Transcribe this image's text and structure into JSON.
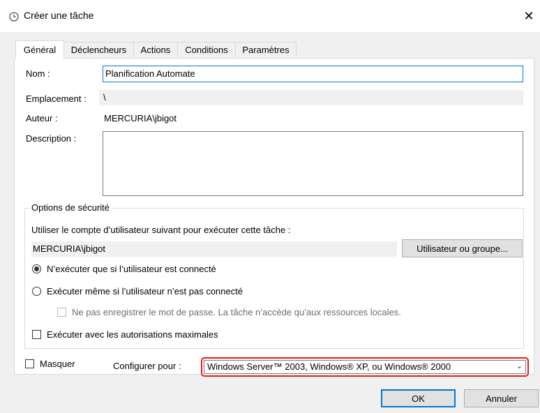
{
  "window": {
    "title": "Créer une tâche",
    "close_glyph": "✕"
  },
  "tabs": [
    {
      "label": "Général",
      "active": true
    },
    {
      "label": "Déclencheurs",
      "active": false
    },
    {
      "label": "Actions",
      "active": false
    },
    {
      "label": "Conditions",
      "active": false
    },
    {
      "label": "Paramètres",
      "active": false
    }
  ],
  "general": {
    "name_label": "Nom :",
    "name_value": "Planification Automate",
    "location_label": "Emplacement :",
    "location_value": "\\",
    "author_label": "Auteur :",
    "author_value": "MERCURIA\\jbigot",
    "description_label": "Description :",
    "description_value": ""
  },
  "security": {
    "legend": "Options de sécurité",
    "account_prompt": "Utiliser le compte d’utilisateur suivant pour exécuter cette tâche :",
    "account_value": "MERCURIA\\jbigot",
    "user_group_button": "Utilisateur ou groupe...",
    "radio_logged_on": "N’exécuter que si l’utilisateur est connecté",
    "radio_logged_on_selected": true,
    "radio_any": "Exécuter même si l’utilisateur n’est pas connecté",
    "radio_any_selected": false,
    "no_store_password": "Ne pas enregistrer le mot de passe. La tâche n’accède qu’aux ressources locales.",
    "highest_privileges": "Exécuter avec les autorisations maximales"
  },
  "footer": {
    "hidden_label": "Masquer",
    "configure_label": "Configurer pour :",
    "configure_value": "Windows Server™ 2003, Windows® XP, ou Windows® 2000",
    "ok_button": "OK",
    "cancel_button": "Annuler"
  },
  "colors": {
    "accent": "#0078d7",
    "highlight_border": "#e21b1b"
  }
}
